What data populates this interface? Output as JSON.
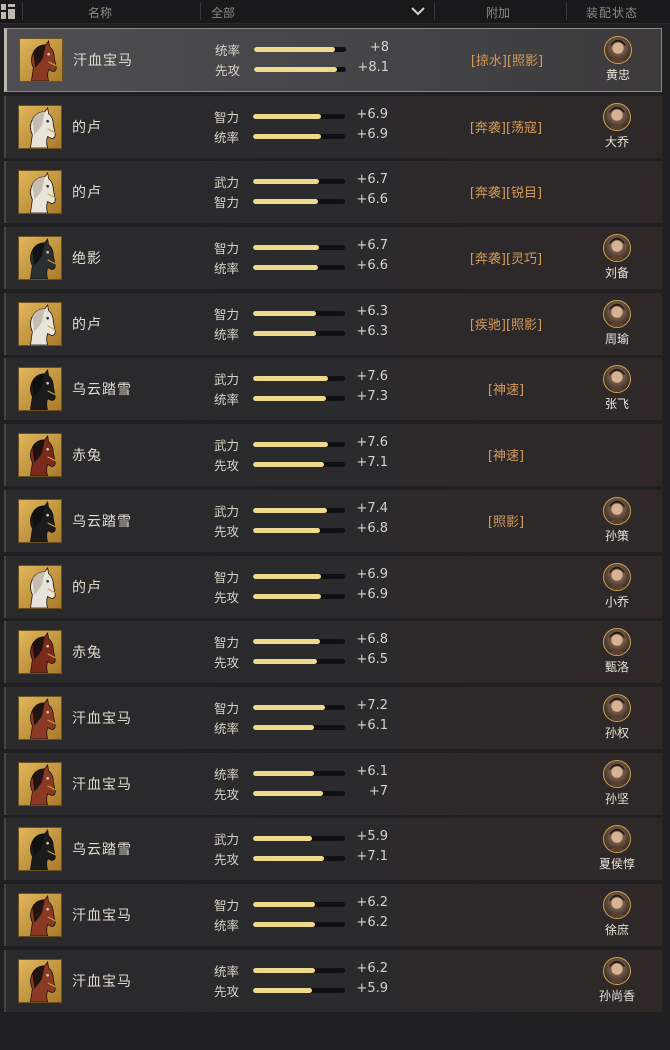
{
  "header": {
    "col_name": "名称",
    "filter_value": "全部",
    "col_bonus": "附加",
    "col_equip": "装配状态"
  },
  "rows": [
    {
      "name": "汗血宝马",
      "icon": "red-horse-icon",
      "stat1": {
        "label": "统率",
        "value": "+8",
        "fill": 0.88
      },
      "stat2": {
        "label": "先攻",
        "value": "+8.1",
        "fill": 0.9
      },
      "tags": "[掠水][照影]",
      "hero": "黄忠",
      "selected": true
    },
    {
      "name": "的卢",
      "icon": "white-horse-icon",
      "stat1": {
        "label": "智力",
        "value": "+6.9",
        "fill": 0.74
      },
      "stat2": {
        "label": "统率",
        "value": "+6.9",
        "fill": 0.74
      },
      "tags": "[奔袭][荡寇]",
      "hero": "大乔"
    },
    {
      "name": "的卢",
      "icon": "white-horse-icon",
      "stat1": {
        "label": "武力",
        "value": "+6.7",
        "fill": 0.72
      },
      "stat2": {
        "label": "智力",
        "value": "+6.6",
        "fill": 0.71
      },
      "tags": "[奔袭][锐目]",
      "hero": ""
    },
    {
      "name": "绝影",
      "icon": "dark-horse-icon",
      "stat1": {
        "label": "智力",
        "value": "+6.7",
        "fill": 0.72
      },
      "stat2": {
        "label": "统率",
        "value": "+6.6",
        "fill": 0.71
      },
      "tags": "[奔袭][灵巧]",
      "hero": "刘备"
    },
    {
      "name": "的卢",
      "icon": "white-horse-icon",
      "stat1": {
        "label": "智力",
        "value": "+6.3",
        "fill": 0.68
      },
      "stat2": {
        "label": "统率",
        "value": "+6.3",
        "fill": 0.68
      },
      "tags": "[疾驰][照影]",
      "hero": "周瑜"
    },
    {
      "name": "乌云踏雪",
      "icon": "black-horse-icon",
      "stat1": {
        "label": "武力",
        "value": "+7.6",
        "fill": 0.82
      },
      "stat2": {
        "label": "统率",
        "value": "+7.3",
        "fill": 0.79
      },
      "tags": "[神速]",
      "hero": "张飞"
    },
    {
      "name": "赤兔",
      "icon": "chitu-horse-icon",
      "stat1": {
        "label": "武力",
        "value": "+7.6",
        "fill": 0.82
      },
      "stat2": {
        "label": "先攻",
        "value": "+7.1",
        "fill": 0.77
      },
      "tags": "[神速]",
      "hero": ""
    },
    {
      "name": "乌云踏雪",
      "icon": "black-horse-icon",
      "stat1": {
        "label": "武力",
        "value": "+7.4",
        "fill": 0.8
      },
      "stat2": {
        "label": "先攻",
        "value": "+6.8",
        "fill": 0.73
      },
      "tags": "[照影]",
      "hero": "孙策"
    },
    {
      "name": "的卢",
      "icon": "white-horse-icon",
      "stat1": {
        "label": "智力",
        "value": "+6.9",
        "fill": 0.74
      },
      "stat2": {
        "label": "先攻",
        "value": "+6.9",
        "fill": 0.74
      },
      "tags": "",
      "hero": "小乔"
    },
    {
      "name": "赤兔",
      "icon": "chitu-horse-icon",
      "stat1": {
        "label": "智力",
        "value": "+6.8",
        "fill": 0.73
      },
      "stat2": {
        "label": "先攻",
        "value": "+6.5",
        "fill": 0.7
      },
      "tags": "",
      "hero": "甄洛"
    },
    {
      "name": "汗血宝马",
      "icon": "red-horse-icon",
      "stat1": {
        "label": "智力",
        "value": "+7.2",
        "fill": 0.78
      },
      "stat2": {
        "label": "统率",
        "value": "+6.1",
        "fill": 0.66
      },
      "tags": "",
      "hero": "孙权"
    },
    {
      "name": "汗血宝马",
      "icon": "red-horse-icon",
      "stat1": {
        "label": "统率",
        "value": "+6.1",
        "fill": 0.66
      },
      "stat2": {
        "label": "先攻",
        "value": "+7",
        "fill": 0.76
      },
      "tags": "",
      "hero": "孙坚"
    },
    {
      "name": "乌云踏雪",
      "icon": "black-horse-icon",
      "stat1": {
        "label": "武力",
        "value": "+5.9",
        "fill": 0.64
      },
      "stat2": {
        "label": "先攻",
        "value": "+7.1",
        "fill": 0.77
      },
      "tags": "",
      "hero": "夏侯惇"
    },
    {
      "name": "汗血宝马",
      "icon": "red-horse-icon",
      "stat1": {
        "label": "智力",
        "value": "+6.2",
        "fill": 0.67
      },
      "stat2": {
        "label": "统率",
        "value": "+6.2",
        "fill": 0.67
      },
      "tags": "",
      "hero": "徐庶"
    },
    {
      "name": "汗血宝马",
      "icon": "red-horse-icon",
      "stat1": {
        "label": "统率",
        "value": "+6.2",
        "fill": 0.67
      },
      "stat2": {
        "label": "先攻",
        "value": "+5.9",
        "fill": 0.64
      },
      "tags": "",
      "hero": "孙尚香"
    }
  ],
  "horse_colors": {
    "red-horse-icon": "#8a3a24",
    "white-horse-icon": "#e8e4dc",
    "dark-horse-icon": "#2a2f30",
    "black-horse-icon": "#1b1b1d",
    "chitu-horse-icon": "#7a2a1a"
  },
  "colors": {
    "accent_bar": "#efd98c",
    "tag_text": "#d49a5c",
    "avatar_ring": "#c8a454"
  }
}
